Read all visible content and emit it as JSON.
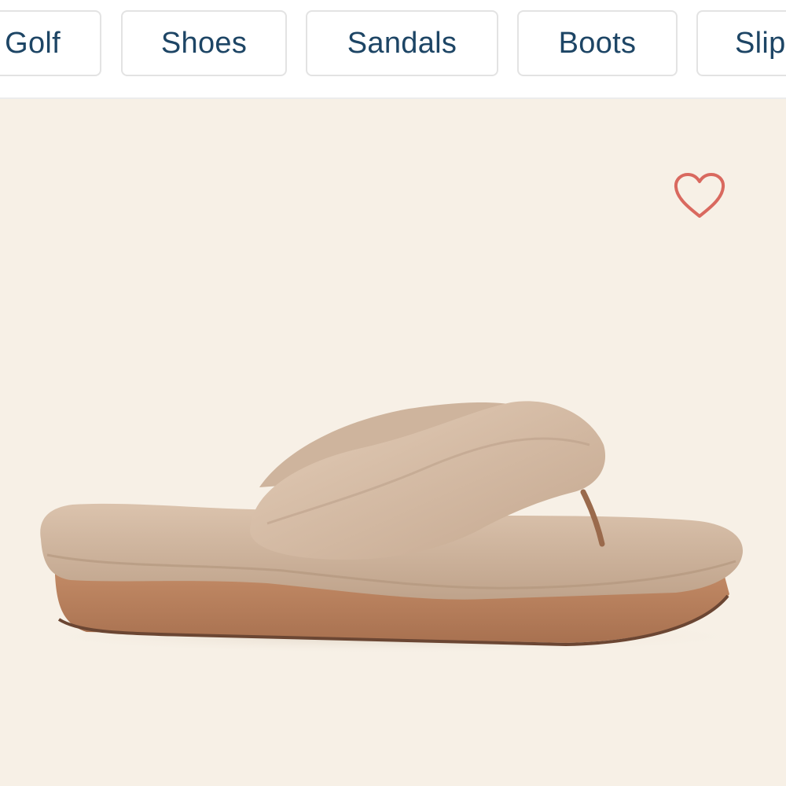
{
  "categories": [
    {
      "label": "Golf"
    },
    {
      "label": "Shoes"
    },
    {
      "label": "Sandals"
    },
    {
      "label": "Boots"
    },
    {
      "label": "Slip"
    }
  ],
  "product": {
    "image_icon": "shearling-flip-flop-sandal",
    "wishlist_icon": "heart-outline-icon",
    "wishlist_color": "#d9695f",
    "background_color": "#f7f0e6"
  },
  "colors": {
    "chip_text": "#1d4565",
    "chip_border": "#e3e3e3"
  }
}
